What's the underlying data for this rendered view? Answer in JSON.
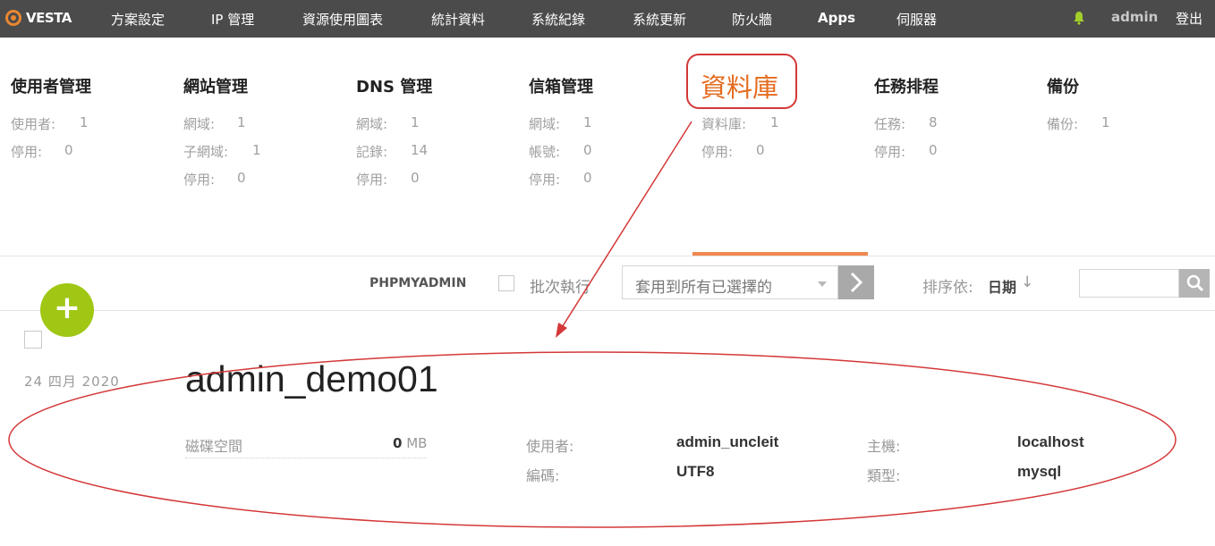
{
  "topbar": {
    "logo_text": "VESTA",
    "nav": [
      "方案設定",
      "IP 管理",
      "資源使用圖表",
      "統計資料",
      "系統紀錄",
      "系統更新",
      "防火牆",
      "Apps",
      "伺服器"
    ],
    "user": "admin",
    "logout": "登出",
    "accent_color": "#e98731"
  },
  "stats": {
    "users": {
      "title": "使用者管理",
      "rows": [
        {
          "label": "使用者:",
          "value": "1"
        },
        {
          "label": "停用:",
          "value": "0"
        }
      ]
    },
    "web": {
      "title": "網站管理",
      "rows": [
        {
          "label": "網域:",
          "value": "1"
        },
        {
          "label": "子網域:",
          "value": "1"
        },
        {
          "label": "停用:",
          "value": "0"
        }
      ]
    },
    "dns": {
      "title": "DNS 管理",
      "rows": [
        {
          "label": "網域:",
          "value": "1"
        },
        {
          "label": "記錄:",
          "value": "14"
        },
        {
          "label": "停用:",
          "value": "0"
        }
      ]
    },
    "mail": {
      "title": "信箱管理",
      "rows": [
        {
          "label": "網域:",
          "value": "1"
        },
        {
          "label": "帳號:",
          "value": "0"
        },
        {
          "label": "停用:",
          "value": "0"
        }
      ]
    },
    "db": {
      "title": "資料庫",
      "rows": [
        {
          "label": "資料庫:",
          "value": "1"
        },
        {
          "label": "停用:",
          "value": "0"
        }
      ]
    },
    "cron": {
      "title": "任務排程",
      "rows": [
        {
          "label": "任務:",
          "value": "8"
        },
        {
          "label": "停用:",
          "value": "0"
        }
      ]
    },
    "backup": {
      "title": "備份",
      "rows": [
        {
          "label": "備份:",
          "value": "1"
        }
      ]
    }
  },
  "toolbar": {
    "phpmyadmin": "PHPMYADMIN",
    "bulk_label": "批次執行",
    "select_placeholder": "套用到所有已選擇的",
    "sort_label": "排序依:",
    "sort_value": "日期",
    "sort_arrow": "↓"
  },
  "record": {
    "date": "24  四月  2020",
    "name": "admin_demo01",
    "disk_label": "磁碟空間",
    "disk_value": "0",
    "disk_unit": "MB",
    "user_label": "使用者:",
    "user_value": "admin_uncleit",
    "encoding_label": "編碼:",
    "encoding_value": "UTF8",
    "host_label": "主機:",
    "host_value": "localhost",
    "type_label": "類型:",
    "type_value": "mysql"
  },
  "colors": {
    "add_button": "#9fc714",
    "annotation": "#d43838",
    "active_tab": "#f0884f"
  }
}
